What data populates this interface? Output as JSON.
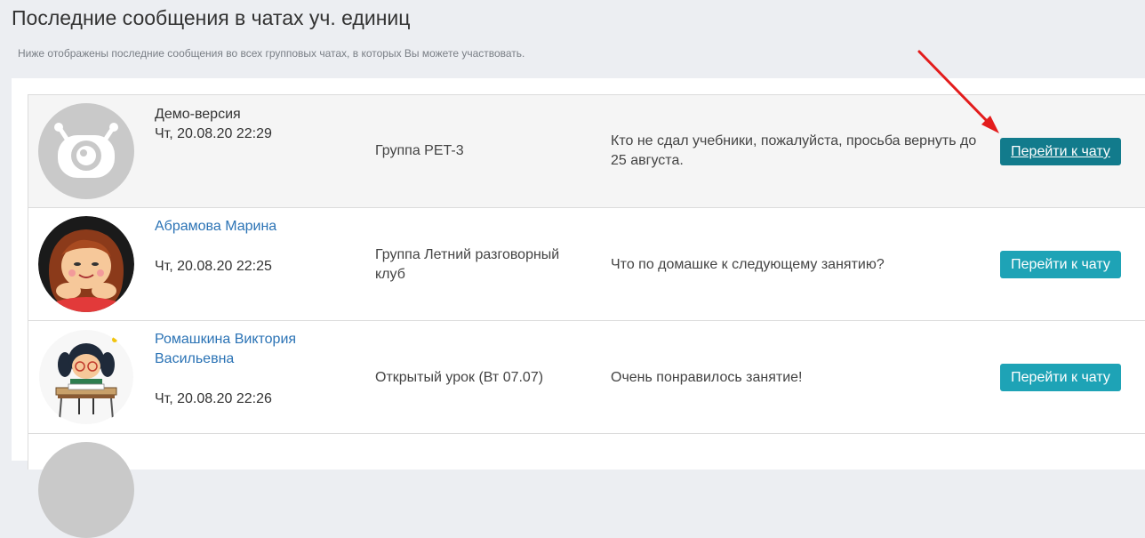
{
  "header": {
    "title": "Последние сообщения в чатах уч. единиц",
    "subtitle": "Ниже отображены последние сообщения во всех групповых чатах, в которых Вы можете участвовать."
  },
  "chats": [
    {
      "sender": "Демо-версия",
      "time": "Чт, 20.08.20 22:29",
      "group": "Группа PET-3",
      "message": "Кто не сдал учебники, пожалуйста, просьба вернуть до 25 августа.",
      "button": "Перейти к чату",
      "avatar_icon": "default-robot-avatar-icon"
    },
    {
      "sender": "Абрамова Марина",
      "time": "Чт, 20.08.20 22:25",
      "group": "Группа Летний разговорный клуб",
      "message": "Что по домашке к следующему занятию?",
      "button": "Перейти к чату",
      "avatar_icon": "girl-cartoon-avatar-icon"
    },
    {
      "sender": "Ромашкина Виктория Васильевна",
      "time": "Чт, 20.08.20 22:26",
      "group": "Открытый урок (Вт 07.07)",
      "message": "Очень понравилось занятие!",
      "button": "Перейти к чату",
      "avatar_icon": "schoolgirl-desk-avatar-icon"
    }
  ],
  "colors": {
    "button": "#1ea3b6",
    "button_hover": "#127b8c",
    "link": "#2b73b5",
    "annotation_arrow": "#e31c1c"
  }
}
